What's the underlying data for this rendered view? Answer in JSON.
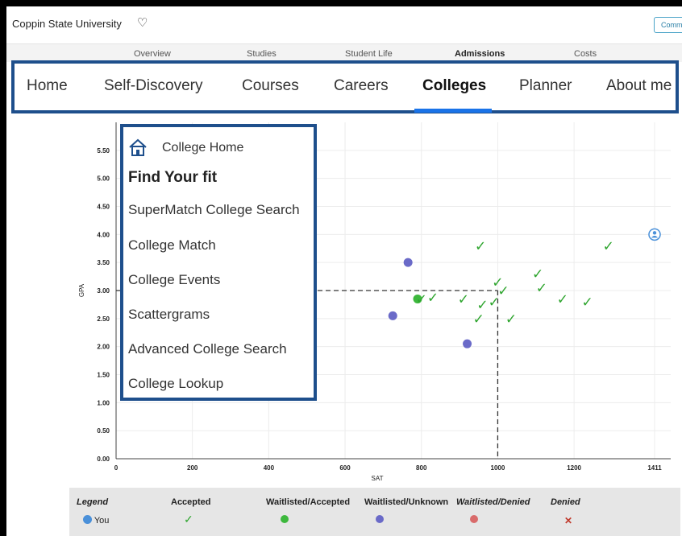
{
  "header": {
    "school": "Coppin State University",
    "comm_button": "Comm"
  },
  "subnav": [
    "Overview",
    "Studies",
    "Student Life",
    "Admissions",
    "Costs"
  ],
  "mainnav": [
    "Home",
    "Self-Discovery",
    "Courses",
    "Careers",
    "Colleges",
    "Planner",
    "About me"
  ],
  "menu": {
    "home_label": "College Home",
    "heading": "Find Your fit",
    "items": [
      "SuperMatch College Search",
      "College Match",
      "College Events",
      "Scattergrams",
      "Advanced College Search",
      "College Lookup"
    ]
  },
  "chart_data": {
    "type": "scatter",
    "xlabel": "SAT",
    "ylabel": "GPA",
    "xlim": [
      0,
      1411
    ],
    "ylim": [
      0,
      6.0
    ],
    "x_ticks": [
      "0",
      "200",
      "400",
      "600",
      "800",
      "1000",
      "1200",
      "1411"
    ],
    "y_ticks": [
      "0.00",
      "0.50",
      "1.00",
      "1.50",
      "2.00",
      "2.50",
      "3.00",
      "3.50",
      "4.00",
      "4.50",
      "5.00",
      "5.50"
    ],
    "you": {
      "x": 1411,
      "y": 4.0,
      "label": "You"
    },
    "reference": {
      "x": 1000,
      "y": 3.0
    },
    "accepted": [
      [
        955,
        3.8
      ],
      [
        1290,
        3.8
      ],
      [
        1000,
        3.15
      ],
      [
        1105,
        3.3
      ],
      [
        1015,
        3.0
      ],
      [
        1115,
        3.05
      ],
      [
        800,
        2.85
      ],
      [
        830,
        2.88
      ],
      [
        910,
        2.85
      ],
      [
        960,
        2.75
      ],
      [
        1170,
        2.85
      ],
      [
        1235,
        2.8
      ],
      [
        1035,
        2.5
      ],
      [
        950,
        2.5
      ],
      [
        990,
        2.8
      ]
    ],
    "waitlisted_accepted": [
      [
        790,
        2.85
      ]
    ],
    "waitlisted_unknown": [
      [
        765,
        3.5
      ],
      [
        725,
        2.55
      ],
      [
        920,
        2.05
      ]
    ],
    "waitlisted_denied": [],
    "denied": []
  },
  "legend": {
    "title": "Legend",
    "you": "You",
    "accepted": "Accepted",
    "waitlisted_accepted": "Waitlisted/Accepted",
    "waitlisted_unknown": "Waitlisted/Unknown",
    "waitlisted_denied": "Waitlisted/Denied",
    "denied": "Denied",
    "colors": {
      "accepted": "#2ea52e",
      "waitlisted_accepted": "#3db83d",
      "waitlisted_unknown": "#6a6ac8",
      "waitlisted_denied": "#d96b6b",
      "denied": "#c0392b",
      "you": "#4a90d9"
    }
  }
}
